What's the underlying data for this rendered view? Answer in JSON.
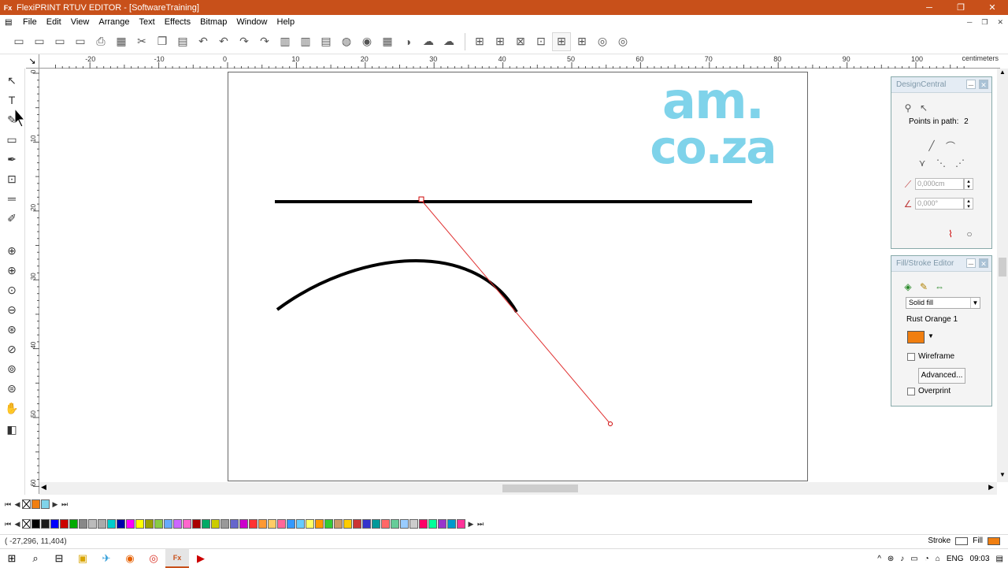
{
  "window": {
    "title": "FlexiPRINT RTUV EDITOR - [SoftwareTraining]",
    "app_icon": "Fx",
    "buttons": [
      "─",
      "❐",
      "✕"
    ]
  },
  "menu": {
    "items": [
      "File",
      "Edit",
      "View",
      "Arrange",
      "Text",
      "Effects",
      "Bitmap",
      "Window",
      "Help"
    ],
    "mdi_buttons": [
      "─",
      "❐",
      "✕"
    ]
  },
  "toolbar": {
    "groups": [
      [
        "new-doc",
        "open",
        "save",
        "save-all",
        "print",
        "print-preview",
        "cut",
        "copy",
        "paste",
        "undo",
        "undo-step",
        "redo",
        "redo-step",
        "import",
        "export",
        "scan",
        "color",
        "zoom-tool",
        "rgb",
        "color-wheel",
        "cloud",
        "upload"
      ],
      [
        "align-1",
        "align-2",
        "align-3",
        "align-4",
        "align-5",
        "align-6",
        "view-1",
        "view-2"
      ]
    ],
    "glyphs": [
      "▭",
      "▭",
      "▭",
      "▭",
      "⎙",
      "▦",
      "✂",
      "❐",
      "▤",
      "↶",
      "↶",
      "↷",
      "↷",
      "▥",
      "▥",
      "▤",
      "◍",
      "◉",
      "▦",
      "◑",
      "☁",
      "☁",
      "⊞",
      "⊞",
      "⊠",
      "⊡",
      "⊞",
      "⊞",
      "◎",
      "◎"
    ]
  },
  "ruler": {
    "unit": "centimeters",
    "top_labels": [
      "-20",
      "-10",
      "0",
      "10",
      "20",
      "30",
      "40",
      "50",
      "60",
      "70",
      "80",
      "90",
      "100"
    ],
    "left_labels": [
      "0",
      "10",
      "20",
      "30",
      "40",
      "50",
      "60"
    ]
  },
  "tools": [
    {
      "name": "select-tool",
      "glyph": "↖"
    },
    {
      "name": "text-tool",
      "glyph": "T"
    },
    {
      "name": "shape-tool",
      "glyph": "✎"
    },
    {
      "name": "rectangle-tool",
      "glyph": "▭"
    },
    {
      "name": "pen-tool",
      "glyph": "✒"
    },
    {
      "name": "crop-tool",
      "glyph": "⊡"
    },
    {
      "name": "measure-tool",
      "glyph": "═"
    },
    {
      "name": "eyedropper-tool",
      "glyph": "✐"
    },
    {
      "name": "zoom-tool",
      "glyph": "⊕"
    },
    {
      "name": "zoom-in-tool",
      "glyph": "⊕"
    },
    {
      "name": "zoom-fit-tool",
      "glyph": "⊙"
    },
    {
      "name": "zoom-out-tool",
      "glyph": "⊖"
    },
    {
      "name": "zoom-selected-tool",
      "glyph": "⊛"
    },
    {
      "name": "zoom-page-tool",
      "glyph": "⊘"
    },
    {
      "name": "zoom-all-tool",
      "glyph": "⊚"
    },
    {
      "name": "zoom-prev-tool",
      "glyph": "⊜"
    },
    {
      "name": "pan-tool",
      "glyph": "✋"
    },
    {
      "name": "fill-tool",
      "glyph": "◧"
    }
  ],
  "logo": {
    "line1": "am.",
    "line2": "co.za",
    "color": "#7fd3ea"
  },
  "design_central": {
    "title": "DesignCentral",
    "points_label": "Points in path:",
    "points_value": "2",
    "field1": "0,000cm",
    "field2": "0,000°"
  },
  "fill_stroke": {
    "title": "Fill/Stroke Editor",
    "fill_type": "Solid fill",
    "color_name": "Rust Orange 1",
    "color": "#f07e10",
    "wireframe_label": "Wireframe",
    "advanced_label": "Advanced...",
    "overprint_label": "Overprint"
  },
  "palette": {
    "row1": [
      "#ffffff",
      "#f07e10",
      "#7fd3ea"
    ],
    "row2": [
      "#ffffff",
      "#000000",
      "#1a1a1a",
      "#0000ff",
      "#cc0000",
      "#00aa00",
      "#888888",
      "#bbbbbb",
      "#aaaaaa",
      "#00cccc",
      "#0000aa",
      "#ff00ff",
      "#ffff00",
      "#9aa100",
      "#88cc44",
      "#66aaff",
      "#cc66ff",
      "#ff66cc",
      "#aa0000",
      "#00aa66",
      "#cccc00",
      "#999999",
      "#6666cc",
      "#cc00cc",
      "#ff3333",
      "#ff9933",
      "#ffcc66",
      "#ff6699",
      "#3399ff",
      "#66ccff",
      "#ffff66",
      "#ff9900",
      "#33cc33",
      "#cc9966",
      "#ffcc00",
      "#cc3333",
      "#3333cc",
      "#009999",
      "#ff6666",
      "#66cc99",
      "#99ccff",
      "#cccccc",
      "#ff0066",
      "#00ff99",
      "#9933cc",
      "#0099cc",
      "#ff3399"
    ]
  },
  "status": {
    "coords": "( -27,296,    11,404)",
    "stroke_label": "Stroke",
    "fill_label": "Fill",
    "fill_color": "#f07e10"
  },
  "taskbar": {
    "items": [
      "⊞",
      "⌕",
      "⊟",
      "▣",
      "✈",
      "◉",
      "◎",
      "Fx",
      "▶"
    ],
    "tray": [
      "^",
      "⊛",
      "♪",
      "▭",
      "◔",
      "⌂",
      "ENG",
      "09:03",
      "▤"
    ]
  }
}
